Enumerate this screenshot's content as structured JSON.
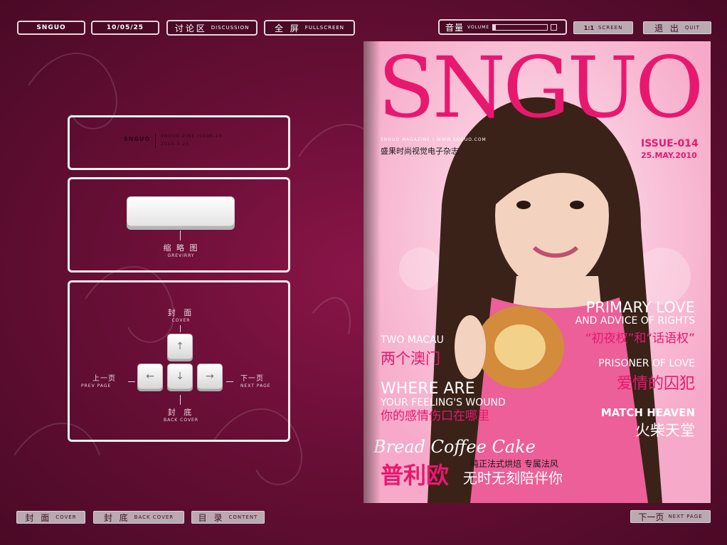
{
  "topbar": {
    "brand": "SNGUO",
    "date": "10/05/25",
    "discussion": {
      "zh": "讨论区",
      "en": "DISCUSSION"
    },
    "fullscreen": {
      "zh": "全 屏",
      "en": "FULLSCREEN"
    },
    "volume": {
      "zh": "音量",
      "en": "VOLUME",
      "level": 0.05
    },
    "screen": {
      "zh": "1:1",
      "en": "SCREEN"
    },
    "quit": {
      "zh": "退 出",
      "en": "QUIT"
    }
  },
  "info_panel": {
    "brand": "SNGUO",
    "line1": "SNGUO ZINE ISSUE-14",
    "line2": "2010-5-25"
  },
  "thumb_panel": {
    "zh": "缩 略 图",
    "en": "GREVIRRY"
  },
  "nav_panel": {
    "cover": {
      "zh": "封 面",
      "en": "COVER"
    },
    "back": {
      "zh": "封 底",
      "en": "BACK COVER"
    },
    "prev": {
      "zh": "上一页",
      "en": "PREV PAGE"
    },
    "next": {
      "zh": "下一页",
      "en": "NEXT PAGE"
    },
    "keys": {
      "up": "↑",
      "left": "←",
      "down": "↓",
      "right": "→"
    }
  },
  "bottombar": {
    "cover": {
      "zh": "封 面",
      "en": "COVER"
    },
    "back": {
      "zh": "封 底",
      "en": "BACK COVER"
    },
    "content": {
      "zh": "目 录",
      "en": "CONTENT"
    },
    "next": {
      "zh": "下一页",
      "en": "NEXT PAGE"
    }
  },
  "magazine": {
    "title": "SNGUO",
    "sub_en": "SNGUO MAGAZINE | WWW.SNGUO.COM",
    "sub_zh": "盛果时尚视觉电子杂志",
    "issue": "ISSUE-014",
    "issue_date": "25.MAY.2010",
    "h1_big": "PRIMARY LOVE",
    "h1_small": "AND ADVICE OF RIGHTS",
    "h1_zh": "“初夜权”和“话语权”",
    "h2_en": "TWO MACAU",
    "h2_zh": "两个澳门",
    "h3_en": "PRISONER OF LOVE",
    "h3_zh": "爱情的囚犯",
    "h4_big": "WHERE ARE",
    "h4_small": "YOUR FEELING'S WOUND",
    "h4_zh": "你的感情伤口在哪里",
    "h5_en": "MATCH HEAVEN",
    "h5_zh": "火柴天堂",
    "h6_script": "Bread Coffee Cake",
    "h6_zh1": "纯正法式烘焙 专属法风",
    "h6_zh2": "普利欧",
    "h6_zh3": "无时无刻陪伴你",
    "colors": {
      "accent": "#e8186f",
      "bg": "#6a0f37"
    }
  }
}
